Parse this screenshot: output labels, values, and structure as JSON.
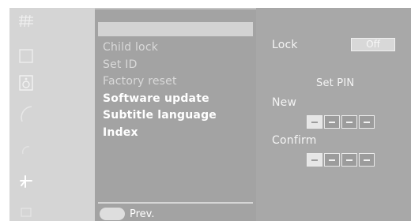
{
  "menu": {
    "items": [
      {
        "label": "Child lock",
        "style": "dim"
      },
      {
        "label": "Set ID",
        "style": "dim"
      },
      {
        "label": "Factory reset",
        "style": "dim"
      },
      {
        "label": "Software update",
        "style": "bright"
      },
      {
        "label": "Subtitle language",
        "style": "bright"
      },
      {
        "label": "Index",
        "style": "bright"
      }
    ],
    "prev_label": "Prev."
  },
  "settings": {
    "lock_label": "Lock",
    "lock_value": "Off",
    "set_pin_title": "Set PIN",
    "new_label": "New",
    "confirm_label": "Confirm",
    "new_pin_digits": [
      "–",
      "–",
      "–",
      "–"
    ],
    "confirm_pin_digits": [
      "–",
      "–",
      "–",
      "–"
    ]
  },
  "sidebar_icons": [
    "grid-icon",
    "square-icon",
    "speaker-icon",
    "arc-icon",
    "small-arc-icon",
    "antenna-icon",
    "box-icon"
  ],
  "colors": {
    "menu_panel_bg": "#a3a3a3",
    "settings_panel_bg": "#a8a8a8",
    "icon_strip_bg": "#d5d5d5",
    "highlight_bar": "#d3d3d3"
  }
}
